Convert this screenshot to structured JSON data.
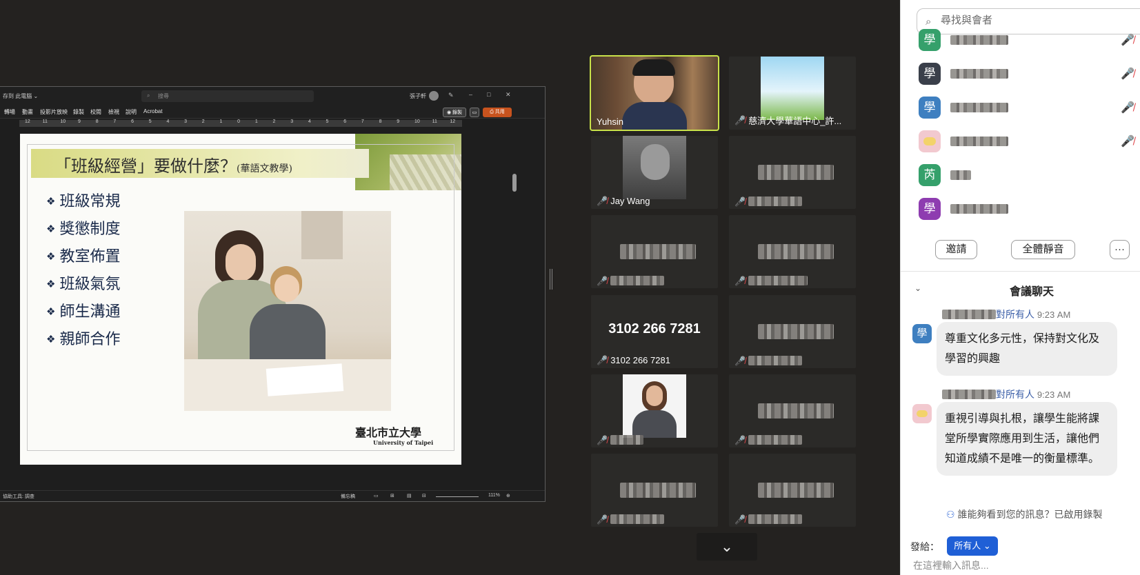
{
  "share": {
    "titlebar_left": "存到 此電腦 ⌄",
    "search_placeholder": "搜尋",
    "user": "張子軒",
    "ribbon_tabs": [
      "轉場",
      "動畫",
      "投影片放映",
      "錄製",
      "校閱",
      "檢視",
      "說明",
      "Acrobat"
    ],
    "record_btn": "◉ 錄製",
    "share_btn": "⎙ 共用",
    "ruler": [
      "12",
      "11",
      "10",
      "9",
      "8",
      "7",
      "6",
      "5",
      "4",
      "3",
      "2",
      "1",
      "0",
      "1",
      "2",
      "3",
      "4",
      "5",
      "6",
      "7",
      "8",
      "9",
      "10",
      "11",
      "12"
    ],
    "slide": {
      "title": "「班級經營」要做什麼？",
      "title_sub": "(華語文教學)",
      "bullets": [
        "班級常規",
        "獎懲制度",
        "教室佈置",
        "班級氣氛",
        "師生溝通",
        "親師合作"
      ],
      "logo_cn": "臺北市立大學",
      "logo_en": "University of Taipei"
    },
    "status": {
      "accessibility": "協助工具: 調查",
      "notes": "備忘稿",
      "zoom": "111%"
    }
  },
  "gallery": {
    "tiles": [
      {
        "id": "yuhsin",
        "name": "Yuhsin"
      },
      {
        "id": "tzuchi",
        "name": "慈濟大學華語中心_許..."
      },
      {
        "id": "jay",
        "name": "Jay Wang"
      },
      {
        "id": "p4",
        "name": ""
      },
      {
        "id": "p5",
        "name": ""
      },
      {
        "id": "p6",
        "name": ""
      },
      {
        "id": "phone",
        "name": "3102 266 7281",
        "big": "3102 266 7281"
      },
      {
        "id": "p8",
        "name": ""
      },
      {
        "id": "p9",
        "name": ""
      },
      {
        "id": "p10",
        "name": ""
      },
      {
        "id": "p11",
        "name": ""
      },
      {
        "id": "p12",
        "name": ""
      }
    ],
    "expand_icon": "⌄"
  },
  "panel": {
    "search_placeholder": "尋找與會者",
    "participants": [
      {
        "avatar": "學",
        "color": "#35a06b"
      },
      {
        "avatar": "學",
        "color": "#3a3f4a"
      },
      {
        "avatar": "學",
        "color": "#3e7fc0"
      },
      {
        "avatar": "",
        "color": "#f2c9cf"
      },
      {
        "avatar": "芮",
        "color": "#35a06b"
      },
      {
        "avatar": "學",
        "color": "#8e3cb0"
      }
    ],
    "buttons": {
      "invite": "邀請",
      "mute_all": "全體靜音",
      "more": "···"
    },
    "chat": {
      "title": "會議聊天",
      "messages": [
        {
          "to": "對所有人",
          "time": "9:23 AM",
          "avatar": "學",
          "text": "尊重文化多元性，保持對文化及學習的興趣"
        },
        {
          "to": "對所有人",
          "time": "9:23 AM",
          "avatar": "",
          "text": "重視引導與扎根，讓學生能將課堂所學實際應用到生活，讓他們知道成績不是唯一的衡量標準。"
        }
      ],
      "privacy": "誰能夠看到您的訊息？已啟用錄製",
      "send_to_label": "發給：",
      "send_to_value": "所有人 ⌄",
      "input_placeholder": "在這裡輸入訊息..."
    }
  }
}
